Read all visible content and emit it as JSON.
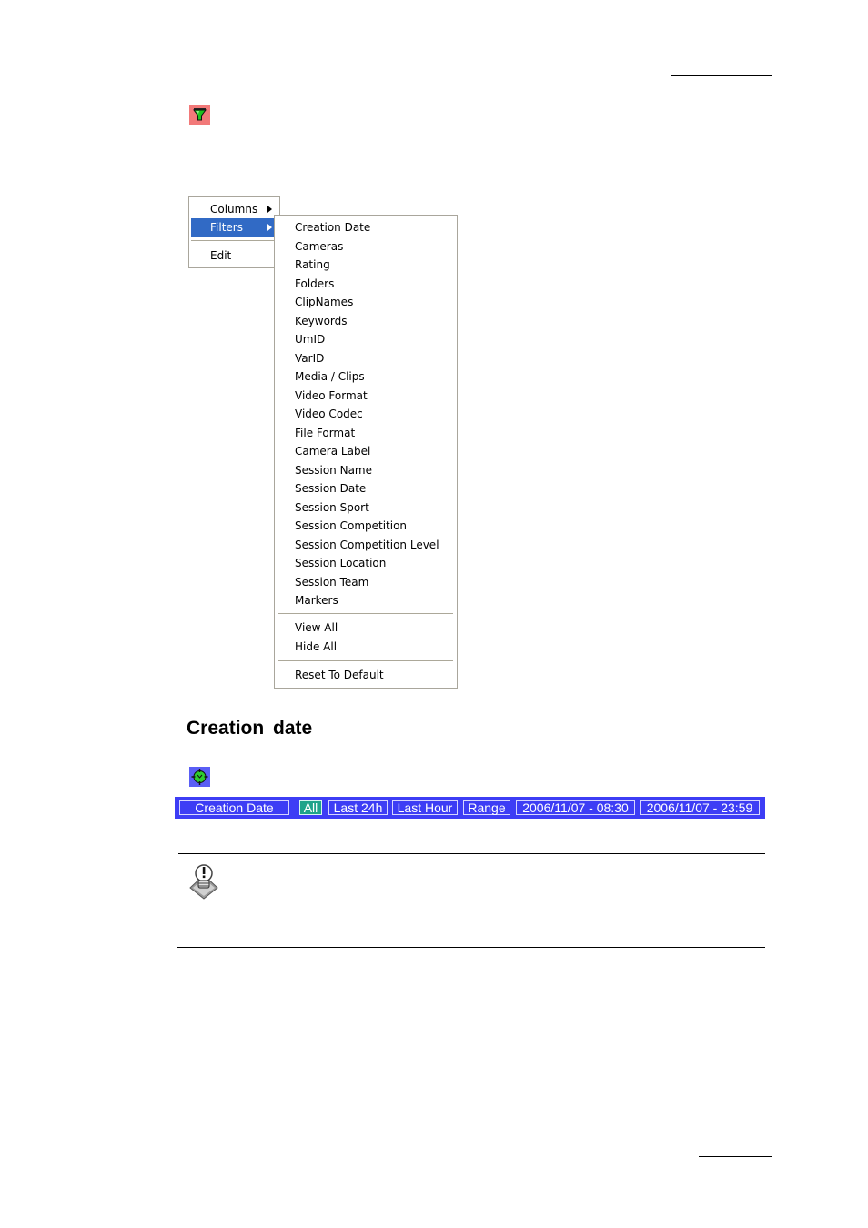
{
  "page": {
    "section_title": "Creation  date"
  },
  "icons": {
    "filter": "filter-funnel-icon",
    "clock": "clock-icon",
    "note": "note-lightbulb-icon"
  },
  "colors": {
    "menu_highlight": "#316ac5",
    "filter_bar_bg": "#3d3df5",
    "active_button": "#1fa38a",
    "filter_icon_bg": "#f27979"
  },
  "context_menu": {
    "items": [
      {
        "label": "Columns",
        "has_submenu": true
      },
      {
        "label": "Filters",
        "has_submenu": true,
        "selected": true
      },
      {
        "label": "Edit",
        "has_submenu": false
      }
    ]
  },
  "filters_submenu": {
    "items": [
      "Creation Date",
      "Cameras",
      "Rating",
      "Folders",
      "ClipNames",
      "Keywords",
      "UmID",
      "VarID",
      "Media / Clips",
      "Video Format",
      "Video Codec",
      "File Format",
      "Camera Label",
      "Session Name",
      "Session Date",
      "Session Sport",
      "Session Competition",
      "Session Competition Level",
      "Session Location",
      "Session Team",
      "Markers"
    ],
    "view_all": "View All",
    "hide_all": "Hide All",
    "reset": "Reset To Default"
  },
  "filter_bar": {
    "field": "Creation Date",
    "buttons": [
      {
        "label": "All",
        "active": true
      },
      {
        "label": "Last 24h",
        "active": false
      },
      {
        "label": "Last Hour",
        "active": false
      },
      {
        "label": "Range",
        "active": false
      }
    ],
    "range_start": "2006/11/07 - 08:30",
    "range_end": "2006/11/07 - 23:59"
  }
}
